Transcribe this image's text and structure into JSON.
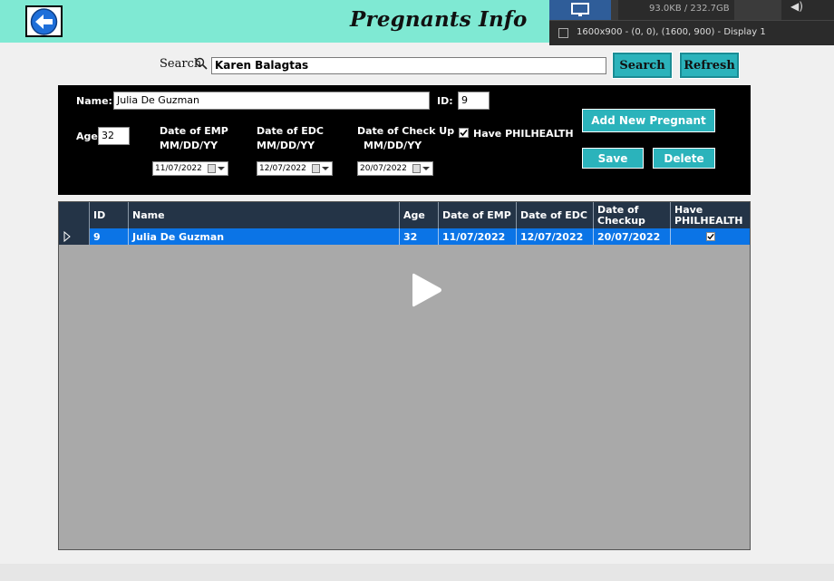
{
  "header": {
    "title": "Pregnants Info",
    "back_icon": "arrow-left-icon",
    "colors": {
      "header_bg": "#7fe9d3",
      "back_icon": "#1e6fd9"
    }
  },
  "recorder": {
    "size_text": "93.0KB / 232.7GB",
    "display_text": "1600x900 - (0, 0), (1600, 900) - Display 1"
  },
  "search": {
    "label": "Search",
    "value": "Karen Balagtas",
    "search_button": "Search",
    "refresh_button": "Refresh"
  },
  "form": {
    "name_label": "Name:",
    "name_value": "Julia De Guzman",
    "id_label": "ID:",
    "id_value": "9",
    "age_label": "Age:",
    "age_value": "32",
    "emp_label_1": "Date of EMP",
    "emp_label_2": "MM/DD/YY",
    "emp_value": "11/07/2022",
    "edc_label_1": "Date of EDC",
    "edc_label_2": "MM/DD/YY",
    "edc_value": "12/07/2022",
    "checkup_label_1": "Date of Check Up",
    "checkup_label_2": "MM/DD/YY",
    "checkup_value": "20/07/2022",
    "philhealth_label": "Have PHILHEALTH",
    "philhealth_checked": true,
    "add_button": "Add New Pregnant",
    "save_button": "Save",
    "delete_button": "Delete"
  },
  "table": {
    "columns": [
      "ID",
      "Name",
      "Age",
      "Date of EMP",
      "Date of EDC",
      "Date of Checkup",
      "Have PHILHEALTH"
    ],
    "rows": [
      {
        "id": "9",
        "name": "Julia De Guzman",
        "age": "32",
        "emp": "11/07/2022",
        "edc": "12/07/2022",
        "checkup": "20/07/2022",
        "philhealth": true
      }
    ],
    "colors": {
      "header_bg": "#243447",
      "selected_row": "#0b74e6",
      "grid_bg": "#a9a9a9"
    }
  }
}
